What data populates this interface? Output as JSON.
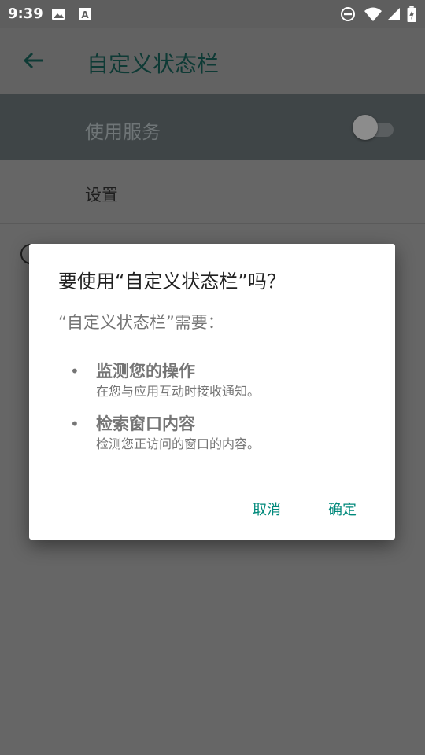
{
  "status_bar": {
    "time": "9:39",
    "left_icons": [
      "image-icon",
      "text-a-icon"
    ],
    "right_icons": [
      "do-not-disturb-icon",
      "wifi-icon",
      "signal-icon",
      "battery-charging-icon"
    ]
  },
  "app_bar": {
    "title": "自定义状态栏",
    "back_icon": "arrow-back-icon"
  },
  "main": {
    "service_label": "使用服务",
    "service_switch_on": false,
    "settings_label": "设置"
  },
  "dialog": {
    "title": "要使用“自定义状态栏”吗？",
    "subtitle": "“自定义状态栏”需要：",
    "permissions": [
      {
        "title": "监测您的操作",
        "desc": "在您与应用互动时接收通知。"
      },
      {
        "title": "检索窗口内容",
        "desc": "检测您正访问的窗口的内容。"
      }
    ],
    "cancel_label": "取消",
    "ok_label": "确定"
  },
  "colors": {
    "accent": "#00897b",
    "scrim_background": "#666666"
  }
}
